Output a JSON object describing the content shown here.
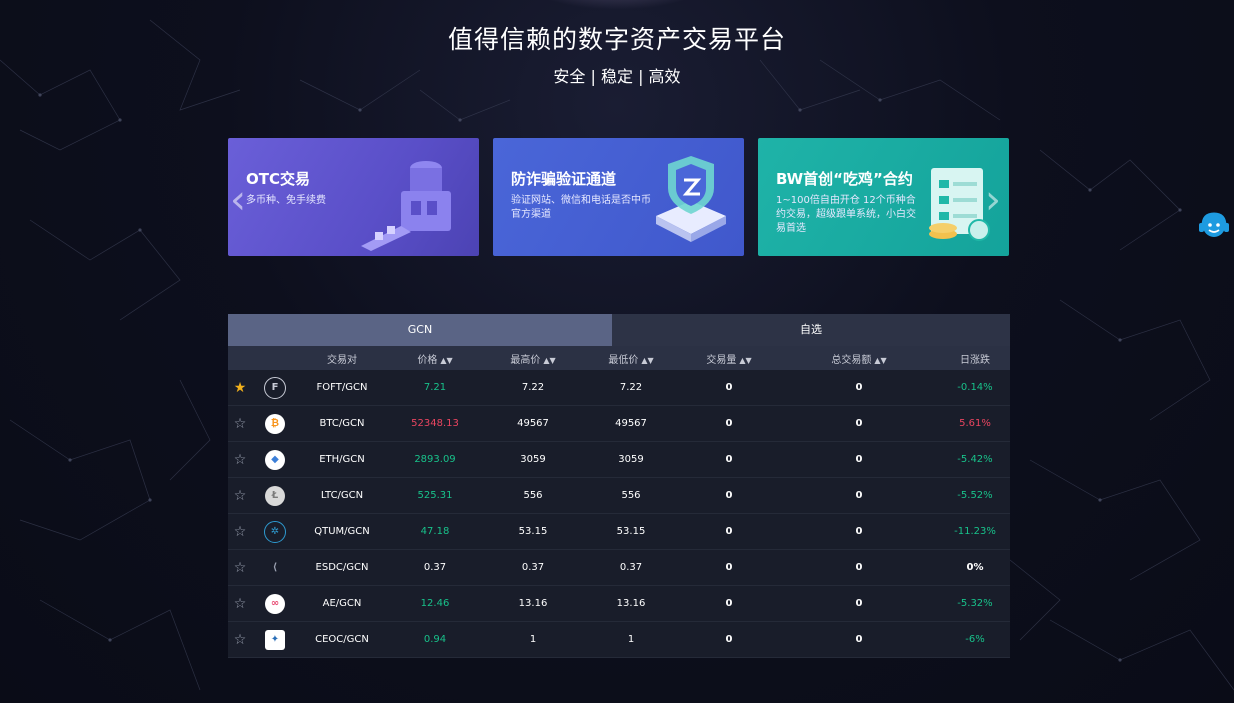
{
  "hero": {
    "title": "值得信赖的数字资产交易平台",
    "subtitle": "安全 | 稳定 | 高效"
  },
  "banners": [
    {
      "title": "OTC交易",
      "desc": "多币种、免手续费",
      "color": "#5a4fc8"
    },
    {
      "title": "防诈骗验证通道",
      "desc": "验证网站、微信和电话是否中币官方渠道",
      "color": "#4058cc"
    },
    {
      "title": "BW首创“吃鸡”合约",
      "desc": "1~100倍自由开仓 12个币种合约交易，超级跟单系统，小白交易首选",
      "color": "#14a39b"
    }
  ],
  "carousel": {
    "prev_icon": "chevron-left-icon",
    "next_icon": "chevron-right-icon"
  },
  "support_icon": "customer-service-icon",
  "market": {
    "tabs": [
      "GCN",
      "自选"
    ],
    "active_tab": "GCN",
    "headers": {
      "pair": "交易对",
      "price": "价格",
      "high": "最高价",
      "low": "最低价",
      "volume": "交易量",
      "amount": "总交易额",
      "change": "日涨跌"
    },
    "rows": [
      {
        "favorited": true,
        "icon": "fo-coin-icon",
        "pair": "FOFT/GCN",
        "price": "7.21",
        "price_trend": "up",
        "high": "7.22",
        "low": "7.22",
        "volume": "0",
        "amount": "0",
        "change": "-0.14%",
        "change_trend": "up"
      },
      {
        "favorited": false,
        "icon": "bitcoin-icon",
        "pair": "BTC/GCN",
        "price": "52348.13",
        "price_trend": "down",
        "high": "49567",
        "low": "49567",
        "volume": "0",
        "amount": "0",
        "change": "5.61%",
        "change_trend": "down"
      },
      {
        "favorited": false,
        "icon": "ethereum-icon",
        "pair": "ETH/GCN",
        "price": "2893.09",
        "price_trend": "up",
        "high": "3059",
        "low": "3059",
        "volume": "0",
        "amount": "0",
        "change": "-5.42%",
        "change_trend": "up"
      },
      {
        "favorited": false,
        "icon": "litecoin-icon",
        "pair": "LTC/GCN",
        "price": "525.31",
        "price_trend": "up",
        "high": "556",
        "low": "556",
        "volume": "0",
        "amount": "0",
        "change": "-5.52%",
        "change_trend": "up"
      },
      {
        "favorited": false,
        "icon": "qtum-icon",
        "pair": "QTUM/GCN",
        "price": "47.18",
        "price_trend": "up",
        "high": "53.15",
        "low": "53.15",
        "volume": "0",
        "amount": "0",
        "change": "-11.23%",
        "change_trend": "up"
      },
      {
        "favorited": false,
        "icon": "esdc-icon",
        "pair": "ESDC/GCN",
        "price": "0.37",
        "price_trend": "flat",
        "high": "0.37",
        "low": "0.37",
        "volume": "0",
        "amount": "0",
        "change": "0%",
        "change_trend": "flat"
      },
      {
        "favorited": false,
        "icon": "aeternity-icon",
        "pair": "AE/GCN",
        "price": "12.46",
        "price_trend": "up",
        "high": "13.16",
        "low": "13.16",
        "volume": "0",
        "amount": "0",
        "change": "-5.32%",
        "change_trend": "up"
      },
      {
        "favorited": false,
        "icon": "ceoc-icon",
        "pair": "CEOC/GCN",
        "price": "0.94",
        "price_trend": "up",
        "high": "1",
        "low": "1",
        "volume": "0",
        "amount": "0",
        "change": "-6%",
        "change_trend": "up"
      }
    ]
  },
  "colors": {
    "up": "#18c18a",
    "down": "#e94560",
    "star_active": "#f2b11c",
    "accent_tab": "#5a6485"
  }
}
